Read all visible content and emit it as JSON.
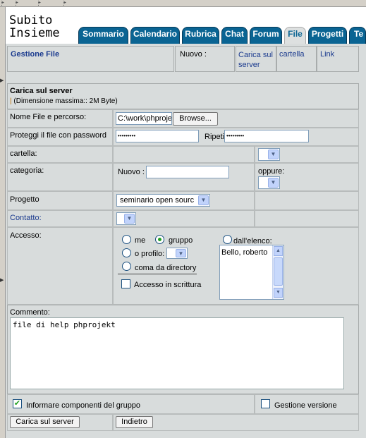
{
  "frame": {
    "top_segments": [
      "▸",
      "▸",
      "▸",
      "▸"
    ]
  },
  "logo": {
    "line1": "Subito",
    "line2": "Insieme"
  },
  "tabs": [
    {
      "label": "Sommario"
    },
    {
      "label": "Calendario"
    },
    {
      "label": "Rubrica"
    },
    {
      "label": "Chat"
    },
    {
      "label": "Forum"
    },
    {
      "label": "File",
      "active": true
    },
    {
      "label": "Progetti"
    },
    {
      "label": "Te"
    }
  ],
  "header": {
    "title": "Gestione File",
    "new_label": "Nuovo :",
    "links": [
      "Carica sul server",
      "cartella",
      "Link"
    ]
  },
  "upload": {
    "title": "Carica sul server",
    "subtitle": "(Dimensione massima:: 2M Byte)",
    "file_label": "Nome File e percorso:",
    "file_value": "C:\\work\\phproje",
    "browse_label": "Browse...",
    "password_label": "Proteggi il file con password",
    "password_value": "•••••••••",
    "repeat_label": "Ripeti",
    "repeat_value": "•••••••••",
    "folder_label": "cartella:",
    "category_label": "categoria:",
    "category_new_label": "Nuovo :",
    "category_or_label": "oppure:",
    "project_label": "Progetto",
    "project_value": "seminario open sourc",
    "contact_label": "Contatto:",
    "access_label": "Accesso:",
    "access_me": "me",
    "access_group": "gruppo",
    "access_profile": "o profilo:",
    "access_directory": "coma da directory",
    "access_list": "dall'elenco:",
    "access_list_items": [
      "Bello, roberto"
    ],
    "write_access": "Accesso in scrittura",
    "comment_label": "Commento:",
    "comment_value": "file di help phprojekt",
    "inform_label": "Informare componenti del gruppo",
    "version_label": "Gestione versione",
    "upload_button": "Carica sul server",
    "back_button": "Indietro"
  },
  "colors": {
    "tab_bg": "#0a6493",
    "link": "#1a3a8e",
    "panel": "#d8dcdc"
  }
}
